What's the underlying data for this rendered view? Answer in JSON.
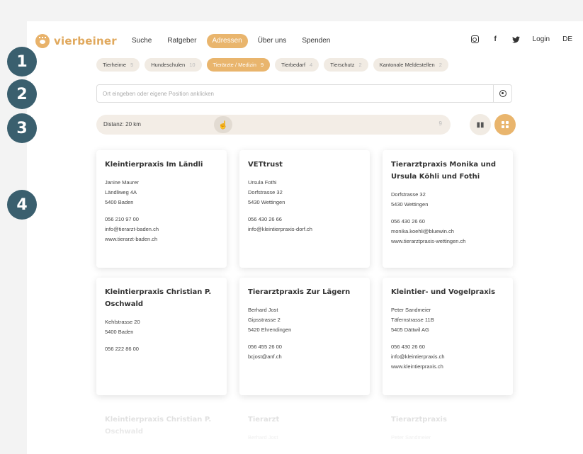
{
  "brand": {
    "logo_text": "vierbeiner",
    "accent": "#e9b56d",
    "badge_color": "#3a5f6e"
  },
  "nav": {
    "items": [
      {
        "label": "Suche",
        "active": false
      },
      {
        "label": "Ratgeber",
        "active": false
      },
      {
        "label": "Adressen",
        "active": true
      },
      {
        "label": "Über uns",
        "active": false
      },
      {
        "label": "Spenden",
        "active": false
      }
    ],
    "social_icons": [
      "instagram-icon",
      "facebook-icon",
      "twitter-icon"
    ],
    "login": "Login",
    "language": "DE"
  },
  "categories": [
    {
      "label": "Tierheime",
      "count": "5",
      "active": false
    },
    {
      "label": "Hundeschulen",
      "count": "10",
      "active": false
    },
    {
      "label": "Tierärzte / Medizin",
      "count": "9",
      "active": true
    },
    {
      "label": "Tierbedarf",
      "count": "4",
      "active": false
    },
    {
      "label": "Tierschutz",
      "count": "2",
      "active": false
    },
    {
      "label": "Kantonale Meldestellen",
      "count": "2",
      "active": false
    }
  ],
  "search": {
    "placeholder": "Ort eingeben oder eigene Position anklicken",
    "value": ""
  },
  "distance": {
    "label": "Distanz: 20 km",
    "value_km": 20,
    "end_label": "9"
  },
  "view_toggle": {
    "map_icon": "map-icon",
    "grid_icon": "grid-icon",
    "active": "grid"
  },
  "badges": [
    "1",
    "2",
    "3",
    "4"
  ],
  "listings": [
    {
      "title": "Kleintierpraxis Im Ländli",
      "lines": [
        "Janine Maurer",
        "Ländliweg 4A",
        "5400 Baden"
      ],
      "contact": [
        "056 210 97 00",
        "info@tierarzt-baden.ch",
        "www.tierarzt-baden.ch"
      ]
    },
    {
      "title": "VETtrust",
      "lines": [
        "Ursula Fothi",
        "Dorfstrasse 32",
        "5430 Wettingen"
      ],
      "contact": [
        "056 430 26 66",
        "info@kleintierpraxis-dorf.ch"
      ]
    },
    {
      "title": "Tierarztpraxis Monika und Ursula Köhli und Fothi",
      "lines": [
        "Dorfstrasse 32",
        "5430 Wettingen"
      ],
      "contact": [
        "056 430 26 60",
        "monika.koehli@bluewin.ch",
        "www.tierarztpraxis-wettingen.ch"
      ]
    },
    {
      "title": "Kleintierpraxis Christian P. Oschwald",
      "lines": [
        "Kehlstrasse 20",
        "5400 Baden"
      ],
      "contact": [
        "056 222 86 00"
      ]
    },
    {
      "title": "Tierarztpraxis Zur Lägern",
      "lines": [
        "Berhard Jost",
        "Gipsstrasse 2",
        "5420 Ehrendingen"
      ],
      "contact": [
        "056 455 26 00",
        "bcjost@anf.ch"
      ]
    },
    {
      "title": "Kleintier- und Vogelpraxis",
      "lines": [
        "Peter Sandmeier",
        "Täfernstrasse 11B",
        "5405 Dättwil AG"
      ],
      "contact": [
        "056 430 26 60",
        "info@kleintierpraxis.ch",
        "www.kleintierpraxis.ch"
      ]
    },
    {
      "title": "Kleintierpraxis Christian P. Oschwald",
      "lines": [],
      "contact": [],
      "faded": true
    },
    {
      "title": "Tierarzt",
      "lines": [
        "Berhard Jost"
      ],
      "contact": [],
      "faded": true
    },
    {
      "title": "Tierarztpraxis",
      "lines": [
        "Peter Sandmeier"
      ],
      "contact": [],
      "faded": true
    }
  ]
}
